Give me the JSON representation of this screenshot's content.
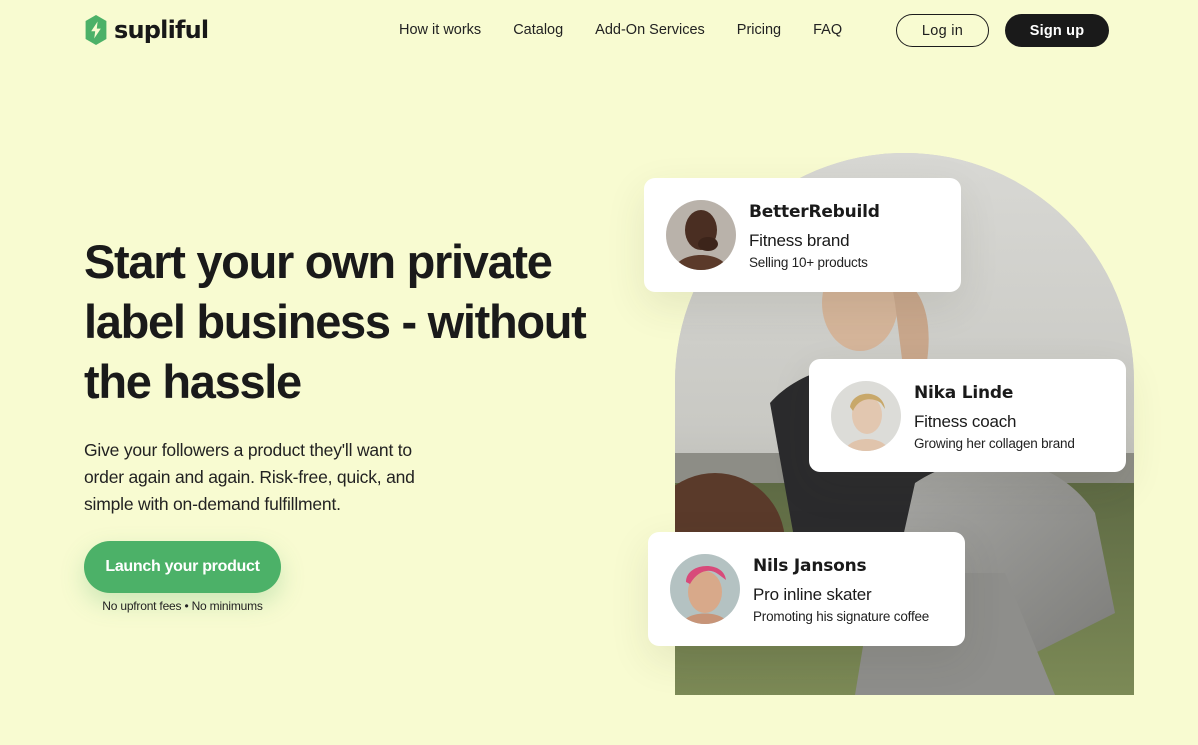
{
  "brand": {
    "name": "supliful",
    "icon": "bolt-icon",
    "accent": "#4cb168"
  },
  "nav": {
    "links": [
      "How it works",
      "Catalog",
      "Add-On Services",
      "Pricing",
      "FAQ"
    ],
    "login_label": "Log in",
    "signup_label": "Sign up"
  },
  "hero": {
    "title": "Start your own private label business - without the hassle",
    "subtitle": "Give your followers a product they'll want to order again and again. Risk-free, quick, and simple with on-demand fulfillment.",
    "cta_label": "Launch your product",
    "cta_note": "No upfront fees • No minimums"
  },
  "cards": [
    {
      "name": "BetterRebuild",
      "role": "Fitness brand",
      "desc": "Selling 10+ products"
    },
    {
      "name": "Nika Linde",
      "role": "Fitness coach",
      "desc": "Growing her collagen brand"
    },
    {
      "name": "Nils Jansons",
      "role": "Pro inline skater",
      "desc": "Promoting his signature coffee"
    }
  ],
  "colors": {
    "background": "#f8fbd1",
    "dark": "#1a1a1a"
  }
}
